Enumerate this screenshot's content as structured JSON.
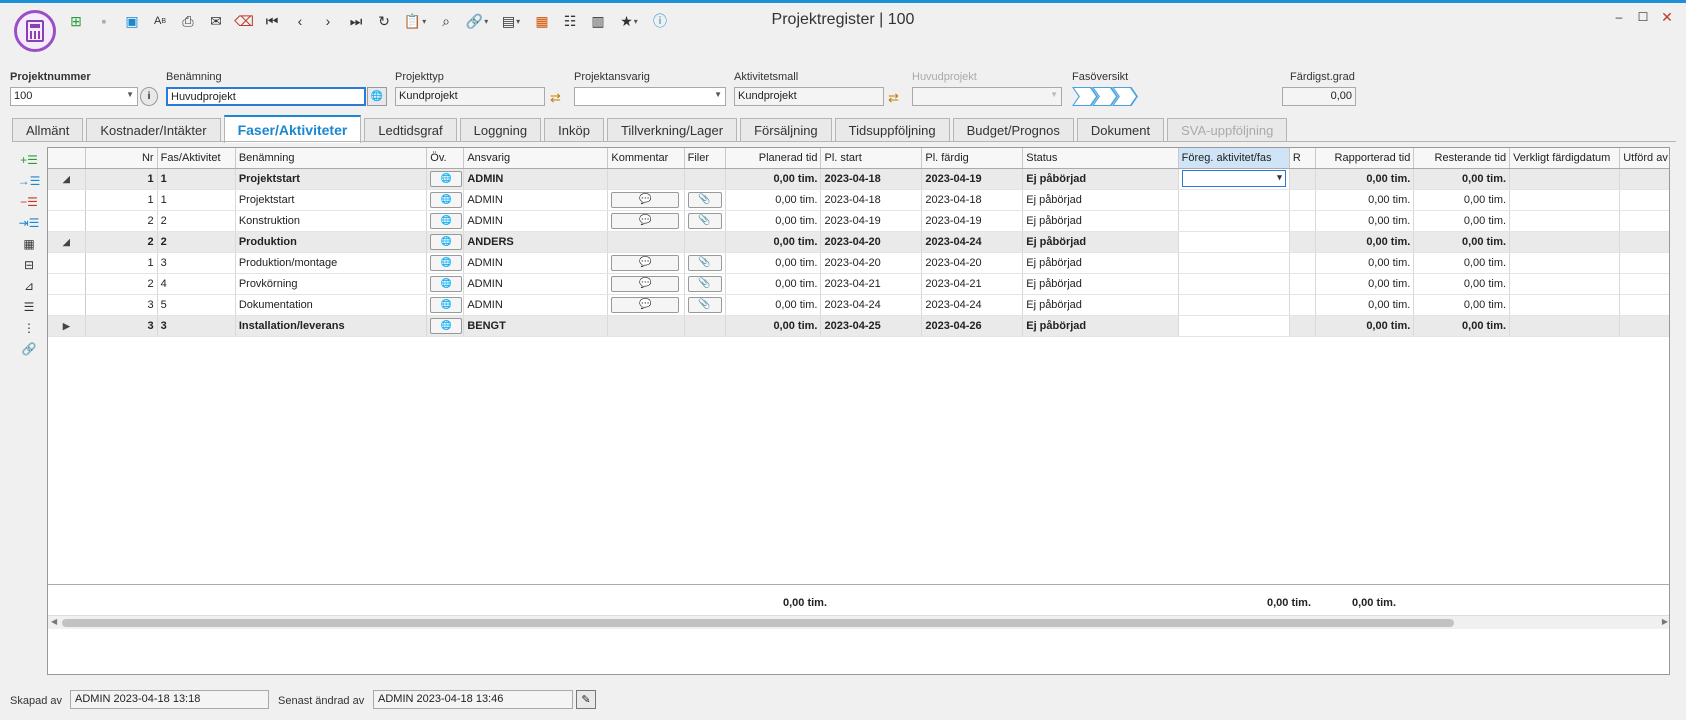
{
  "window": {
    "title": "Projektregister | 100"
  },
  "toolbar": {
    "icons": [
      "new-icon",
      "save-icon",
      "save-as-icon",
      "spellcheck-icon",
      "print-icon",
      "email-icon",
      "delete-icon",
      "first-icon",
      "previous-icon",
      "next-icon",
      "last-icon",
      "refresh-icon",
      "clipboard-icon",
      "search-icon",
      "link-icon",
      "layout-icon",
      "grid-colors-icon",
      "settings-icon",
      "split-icon",
      "favorites-icon",
      "help-icon"
    ]
  },
  "header": {
    "projektnummer_label": "Projektnummer",
    "projektnummer_value": "100",
    "benamning_label": "Benämning",
    "benamning_value": "Huvudprojekt",
    "projekttyp_label": "Projekttyp",
    "projekttyp_value": "Kundprojekt",
    "projektansvarig_label": "Projektansvarig",
    "projektansvarig_value": "",
    "aktivitetsmall_label": "Aktivitetsmall",
    "aktivitetsmall_value": "Kundprojekt",
    "huvudprojekt_label": "Huvudprojekt",
    "huvudprojekt_value": "",
    "fasoversikt_label": "Fasöversikt",
    "fardigst_label": "Färdigst.grad",
    "fardigst_value": "0,00"
  },
  "tabs": [
    {
      "label": "Allmänt"
    },
    {
      "label": "Kostnader/Intäkter"
    },
    {
      "label": "Faser/Aktiviteter"
    },
    {
      "label": "Ledtidsgraf"
    },
    {
      "label": "Loggning"
    },
    {
      "label": "Inköp"
    },
    {
      "label": "Tillverkning/Lager"
    },
    {
      "label": "Försäljning"
    },
    {
      "label": "Tidsuppföljning"
    },
    {
      "label": "Budget/Prognos"
    },
    {
      "label": "Dokument"
    },
    {
      "label": "SVA-uppföljning"
    }
  ],
  "grid": {
    "columns": {
      "nr": "Nr",
      "fas": "Fas/Aktivitet",
      "benamning": "Benämning",
      "ov": "Öv.",
      "ansvarig": "Ansvarig",
      "kommentar": "Kommentar",
      "filer": "Filer",
      "planerad": "Planerad tid",
      "plstart": "Pl. start",
      "plfardig": "Pl. färdig",
      "status": "Status",
      "foreg": "Föreg. aktivitet/fas",
      "r": "R",
      "rapporterad": "Rapporterad tid",
      "resterande": "Resterande tid",
      "verkligt": "Verkligt färdigdatum",
      "utford": "Utförd av"
    },
    "unit": "tim.",
    "rows": [
      {
        "phase": true,
        "expand": "◢",
        "nr": "1",
        "fas": "1",
        "benamning": "Projektstart",
        "ansvarig": "ADMIN",
        "planerad": "0,00",
        "plstart": "2023-04-18",
        "plfardig": "2023-04-19",
        "status": "Ej påbörjad",
        "rapporterad": "0,00",
        "resterande": "0,00"
      },
      {
        "phase": false,
        "nr": "1",
        "fas": "1",
        "benamning": "Projektstart",
        "ansvarig": "ADMIN",
        "planerad": "0,00",
        "plstart": "2023-04-18",
        "plfardig": "2023-04-18",
        "status": "Ej påbörjad",
        "rapporterad": "0,00",
        "resterande": "0,00"
      },
      {
        "phase": false,
        "nr": "2",
        "fas": "2",
        "benamning": "Konstruktion",
        "ansvarig": "ADMIN",
        "planerad": "0,00",
        "plstart": "2023-04-19",
        "plfardig": "2023-04-19",
        "status": "Ej påbörjad",
        "rapporterad": "0,00",
        "resterande": "0,00"
      },
      {
        "phase": true,
        "expand": "◢",
        "nr": "2",
        "fas": "2",
        "benamning": "Produktion",
        "ansvarig": "ANDERS",
        "planerad": "0,00",
        "plstart": "2023-04-20",
        "plfardig": "2023-04-24",
        "status": "Ej påbörjad",
        "rapporterad": "0,00",
        "resterande": "0,00"
      },
      {
        "phase": false,
        "nr": "1",
        "fas": "3",
        "benamning": "Produktion/montage",
        "ansvarig": "ADMIN",
        "planerad": "0,00",
        "plstart": "2023-04-20",
        "plfardig": "2023-04-20",
        "status": "Ej påbörjad",
        "rapporterad": "0,00",
        "resterande": "0,00"
      },
      {
        "phase": false,
        "nr": "2",
        "fas": "4",
        "benamning": "Provkörning",
        "ansvarig": "ADMIN",
        "planerad": "0,00",
        "plstart": "2023-04-21",
        "plfardig": "2023-04-21",
        "status": "Ej påbörjad",
        "rapporterad": "0,00",
        "resterande": "0,00"
      },
      {
        "phase": false,
        "nr": "3",
        "fas": "5",
        "benamning": "Dokumentation",
        "ansvarig": "ADMIN",
        "planerad": "0,00",
        "plstart": "2023-04-24",
        "plfardig": "2023-04-24",
        "status": "Ej påbörjad",
        "rapporterad": "0,00",
        "resterande": "0,00"
      },
      {
        "phase": true,
        "expand": "▶",
        "nr": "3",
        "fas": "3",
        "benamning": "Installation/leverans",
        "ansvarig": "BENGT",
        "planerad": "0,00",
        "plstart": "2023-04-25",
        "plfardig": "2023-04-26",
        "status": "Ej påbörjad",
        "rapporterad": "0,00",
        "resterande": "0,00"
      }
    ],
    "totals": {
      "planerad": "0,00 tim.",
      "rapporterad": "0,00 tim.",
      "resterande": "0,00 tim."
    }
  },
  "footer": {
    "skapad_label": "Skapad av",
    "skapad_value": "ADMIN 2023-04-18 13:18",
    "andrad_label": "Senast ändrad av",
    "andrad_value": "ADMIN 2023-04-18 13:46"
  }
}
